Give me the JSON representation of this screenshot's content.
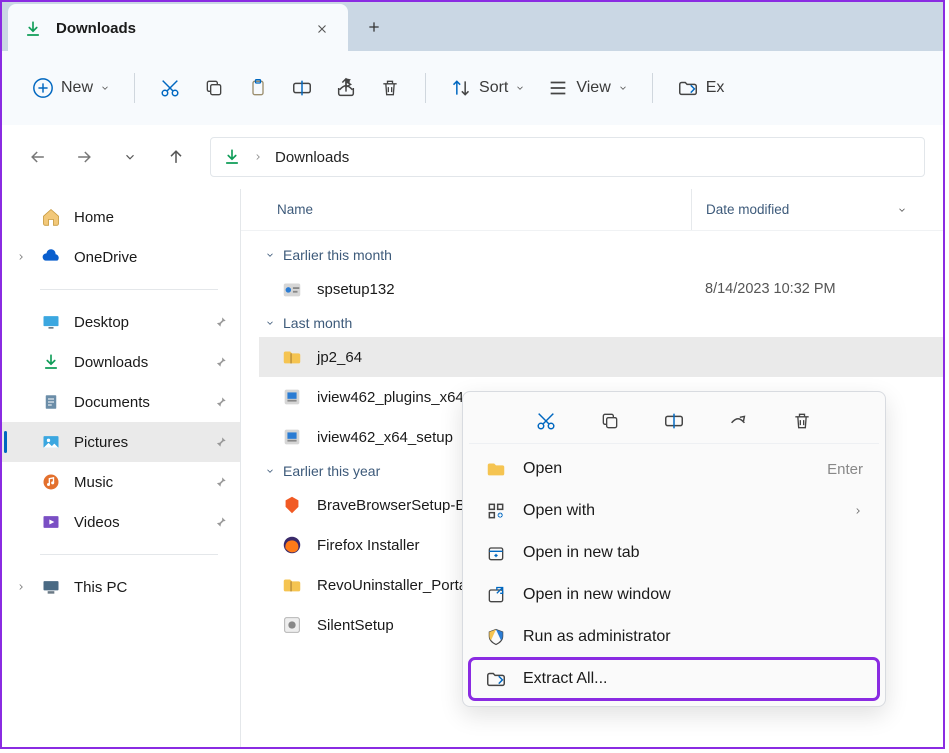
{
  "tab": {
    "title": "Downloads"
  },
  "toolbar": {
    "new": "New",
    "sort": "Sort",
    "view": "View",
    "extract": "Ex"
  },
  "breadcrumb": {
    "current": "Downloads"
  },
  "sidebar": {
    "items": [
      {
        "label": "Home"
      },
      {
        "label": "OneDrive"
      },
      {
        "label": "Desktop"
      },
      {
        "label": "Downloads"
      },
      {
        "label": "Documents"
      },
      {
        "label": "Pictures"
      },
      {
        "label": "Music"
      },
      {
        "label": "Videos"
      },
      {
        "label": "This PC"
      }
    ]
  },
  "columns": {
    "name": "Name",
    "date": "Date modified"
  },
  "groups": {
    "g0": {
      "label": "Earlier this month"
    },
    "g1": {
      "label": "Last month"
    },
    "g2": {
      "label": "Earlier this year"
    }
  },
  "files": {
    "f0": {
      "name": "spsetup132",
      "date": "8/14/2023 10:32 PM"
    },
    "f1": {
      "name": "jp2_64"
    },
    "f2": {
      "name": "iview462_plugins_x64"
    },
    "f3": {
      "name": "iview462_x64_setup"
    },
    "f4": {
      "name": "BraveBrowserSetup-B"
    },
    "f5": {
      "name": "Firefox Installer"
    },
    "f6": {
      "name": "RevoUninstaller_Porta"
    },
    "f7": {
      "name": "SilentSetup"
    }
  },
  "context": {
    "open": "Open",
    "open_hint": "Enter",
    "openwith": "Open with",
    "newtab": "Open in new tab",
    "newwin": "Open in new window",
    "admin": "Run as administrator",
    "extract": "Extract All..."
  }
}
